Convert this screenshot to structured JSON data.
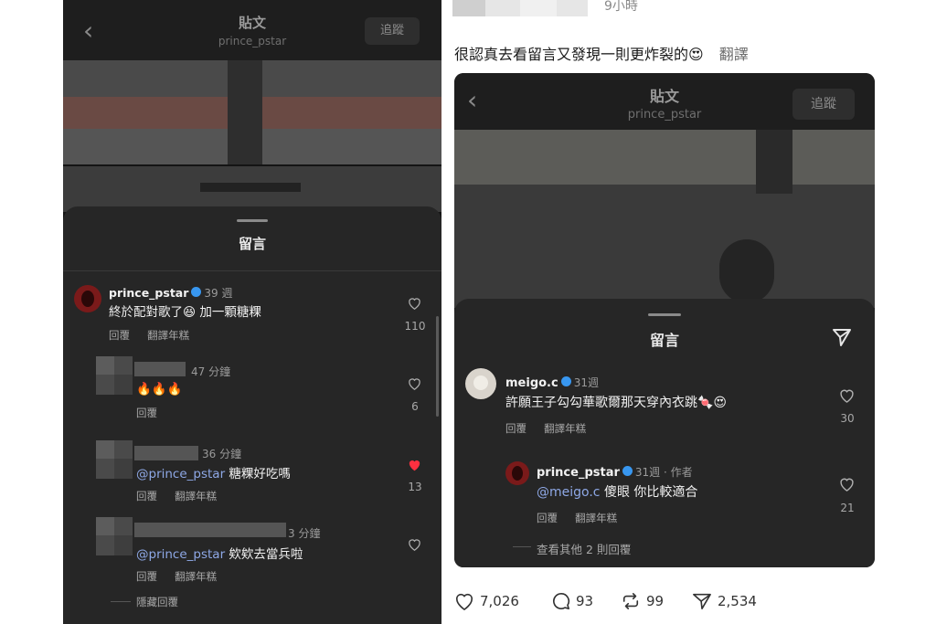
{
  "left": {
    "header": {
      "title": "貼文",
      "username": "prince_pstar",
      "follow_label": "追蹤"
    },
    "sheet_title": "留言",
    "comments": [
      {
        "user": "prince_pstar",
        "time": "39 週",
        "text": "終於配對歌了😆 加一顆糖粿",
        "reply": "回覆",
        "translate": "翻譯年糕",
        "likes": "110"
      },
      {
        "user": "",
        "time": "47 分鐘",
        "text": "🔥🔥🔥",
        "reply": "回覆",
        "likes": "6"
      },
      {
        "user": "",
        "time": "36 分鐘",
        "mention": "@prince_pstar",
        "text": " 糖粿好吃嗎",
        "reply": "回覆",
        "translate": "翻譯年糕",
        "likes": "13"
      },
      {
        "user": "",
        "time": "3 分鐘",
        "mention": "@prince_pstar",
        "text": " 欸欸去當兵啦",
        "reply": "回覆",
        "translate": "翻譯年糕"
      }
    ],
    "hide_replies": "隱藏回覆"
  },
  "right": {
    "top_time": "9小時",
    "caption": "很認真去看留言又發現一則更炸裂的😍",
    "translate": "翻譯",
    "header": {
      "title": "貼文",
      "username": "prince_pstar",
      "follow_label": "追蹤"
    },
    "sheet_title": "留言",
    "comments": [
      {
        "user": "meigo.c",
        "time": "31週",
        "text": "許願王子勾勾華歌爾那天穿內衣跳🍬😍",
        "reply": "回覆",
        "translate": "翻譯年糕",
        "likes": "30"
      },
      {
        "user": "prince_pstar",
        "time": "31週 · 作者",
        "mention": "@meigo.c",
        "text": " 傻眼 你比較適合",
        "reply": "回覆",
        "translate": "翻譯年糕",
        "likes": "21"
      }
    ],
    "view_more": "查看其他 2 則回覆",
    "stats": {
      "likes": "7,026",
      "comments": "93",
      "reposts": "99",
      "shares": "2,534"
    }
  },
  "colors": {
    "like_red": "#ff3040",
    "verified": "#3897f0",
    "mention": "#8ea8e6"
  }
}
